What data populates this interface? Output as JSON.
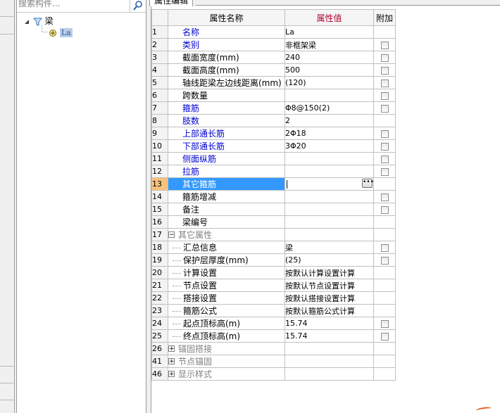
{
  "search": {
    "placeholder": "搜索构件..."
  },
  "tree": {
    "root_label": "梁",
    "child_label": "La"
  },
  "tab": {
    "label": "属性编辑"
  },
  "grid": {
    "headers": {
      "name": "属性名称",
      "value": "属性值",
      "extra": "附加"
    },
    "rows": [
      {
        "num": "1",
        "name": "名称",
        "value": "La",
        "style": "blue",
        "check": false
      },
      {
        "num": "2",
        "name": "类别",
        "value": "非框架梁",
        "style": "blue",
        "check": true
      },
      {
        "num": "3",
        "name": "截面宽度(mm)",
        "value": "240",
        "style": "",
        "check": true
      },
      {
        "num": "4",
        "name": "截面高度(mm)",
        "value": "500",
        "style": "",
        "check": true
      },
      {
        "num": "5",
        "name": "轴线距梁左边线距离(mm)",
        "value": "(120)",
        "style": "",
        "check": true
      },
      {
        "num": "6",
        "name": "跨数量",
        "value": "",
        "style": "",
        "check": true
      },
      {
        "num": "7",
        "name": "箍筋",
        "value": "Φ8@150(2)",
        "style": "blue",
        "check": true
      },
      {
        "num": "8",
        "name": "肢数",
        "value": "2",
        "style": "blue",
        "check": false
      },
      {
        "num": "9",
        "name": "上部通长筋",
        "value": "2Φ18",
        "style": "blue",
        "check": true
      },
      {
        "num": "10",
        "name": "下部通长筋",
        "value": "3Φ20",
        "style": "blue",
        "check": true
      },
      {
        "num": "11",
        "name": "侧面纵筋",
        "value": "",
        "style": "blue",
        "check": true
      },
      {
        "num": "12",
        "name": "拉筋",
        "value": "",
        "style": "blue",
        "check": true
      },
      {
        "num": "13",
        "name": "其它箍筋",
        "value": "",
        "style": "sel",
        "check": false
      },
      {
        "num": "14",
        "name": "箍筋增减",
        "value": "",
        "style": "",
        "check": true
      },
      {
        "num": "15",
        "name": "备注",
        "value": "",
        "style": "",
        "check": true
      },
      {
        "num": "16",
        "name": "梁编号",
        "value": "",
        "style": "",
        "check": false
      },
      {
        "num": "17",
        "name": "其它属性",
        "value": "",
        "style": "group-open",
        "check": false
      },
      {
        "num": "18",
        "name": "汇总信息",
        "value": "梁",
        "style": "sub",
        "check": true
      },
      {
        "num": "19",
        "name": "保护层厚度(mm)",
        "value": "(25)",
        "style": "sub",
        "check": true
      },
      {
        "num": "20",
        "name": "计算设置",
        "value": "按默认计算设置计算",
        "style": "sub",
        "check": false
      },
      {
        "num": "21",
        "name": "节点设置",
        "value": "按默认节点设置计算",
        "style": "sub",
        "check": false
      },
      {
        "num": "22",
        "name": "搭接设置",
        "value": "按默认搭接设置计算",
        "style": "sub",
        "check": false
      },
      {
        "num": "23",
        "name": "箍筋公式",
        "value": "按默认箍筋公式计算",
        "style": "sub",
        "check": false
      },
      {
        "num": "24",
        "name": "起点顶标高(m)",
        "value": "15.74",
        "style": "sub",
        "check": true
      },
      {
        "num": "25",
        "name": "终点顶标高(m)",
        "value": "15.74",
        "style": "sub",
        "check": true
      },
      {
        "num": "26",
        "name": "锚固搭接",
        "value": "",
        "style": "group-closed",
        "check": false
      },
      {
        "num": "41",
        "name": "节点锚固",
        "value": "",
        "style": "group-closed",
        "check": false
      },
      {
        "num": "46",
        "name": "显示样式",
        "value": "",
        "style": "group-closed",
        "check": false
      }
    ]
  },
  "colors": {
    "header_value_bg": "#f9d9a6",
    "selected_row": "#3399ff",
    "link_blue": "#0000d0"
  }
}
